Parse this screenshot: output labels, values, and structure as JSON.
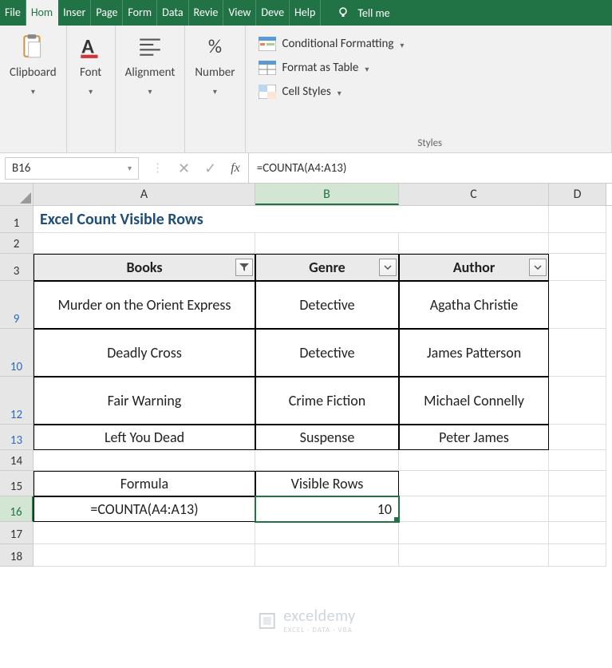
{
  "tabs": {
    "file": "File",
    "home": "Hom",
    "insert": "Inser",
    "page": "Page",
    "formulas": "Form",
    "data": "Data",
    "review": "Revie",
    "view": "View",
    "developer": "Deve",
    "help": "Help",
    "tellme": "Tell me"
  },
  "ribbon": {
    "clipboard": {
      "label": "Clipboard"
    },
    "font": {
      "label": "Font"
    },
    "alignment": {
      "label": "Alignment"
    },
    "number": {
      "label": "Number",
      "pct": "%"
    },
    "styles": {
      "label": "Styles",
      "cond": "Conditional Formatting",
      "table": "Format as Table",
      "cell": "Cell Styles"
    }
  },
  "fbar": {
    "namebox": "B16",
    "formula": "=COUNTA(A4:A13)"
  },
  "cols": {
    "A": "A",
    "B": "B",
    "C": "C",
    "D": "D"
  },
  "sheet": {
    "title": "Excel Count Visible Rows",
    "headers": {
      "books": "Books",
      "genre": "Genre",
      "author": "Author"
    },
    "rows": [
      {
        "n": 9,
        "book": "Murder on the Orient Express",
        "genre": "Detective",
        "author": "Agatha Christie"
      },
      {
        "n": 10,
        "book": "Deadly Cross",
        "genre": "Detective",
        "author": "James Patterson"
      },
      {
        "n": 12,
        "book": "Fair Warning",
        "genre": "Crime Fiction",
        "author": "Michael Connelly"
      },
      {
        "n": 13,
        "book": "Left You Dead",
        "genre": "Suspense",
        "author": "Peter James"
      }
    ],
    "formula_label": "Formula",
    "visible_label": "Visible Rows",
    "formula_text": "=COUNTA(A4:A13)",
    "result": "10"
  },
  "watermark": {
    "name": "exceldemy",
    "sub": "EXCEL · DATA · VBA"
  }
}
